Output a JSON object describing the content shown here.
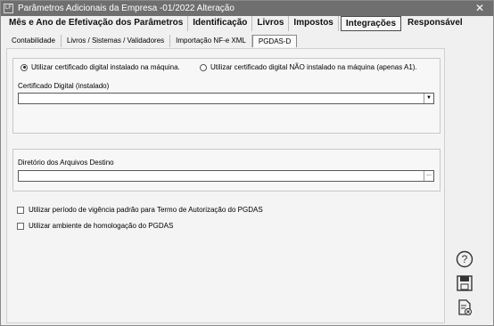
{
  "window": {
    "title": "Parâmetros Adicionais da Empresa -01/2022 Alteração",
    "icon_text": "LF",
    "close_icon": "close-icon"
  },
  "main_tabs": [
    {
      "label": "Mês e Ano de Efetivação dos Parâmetros",
      "active": false
    },
    {
      "label": "Identificação",
      "active": false
    },
    {
      "label": "Livros",
      "active": false
    },
    {
      "label": "Impostos",
      "active": false
    },
    {
      "label": "Integrações",
      "active": true
    },
    {
      "label": "Responsável",
      "active": false
    }
  ],
  "sub_tabs": [
    {
      "label": "Contabilidade",
      "active": false
    },
    {
      "label": "Livros / Sistemas / Validadores",
      "active": false
    },
    {
      "label": "Importação NF-e XML",
      "active": false
    },
    {
      "label": "PGDAS-D",
      "active": true
    }
  ],
  "certificate_group": {
    "radio_installed": {
      "label": "Utilizar certificado digital instalado na máquina.",
      "checked": true
    },
    "radio_not_installed": {
      "label": "Utilizar certificado digital NÃO instalado na máquina (apenas A1).",
      "checked": false
    },
    "cert_label": "Certificado Digital (instalado)",
    "cert_value": "",
    "dropdown_icon": "chevron-down-icon"
  },
  "directory_group": {
    "label": "Diretório dos Arquivos Destino",
    "value": "",
    "browse_label": "..."
  },
  "options": [
    {
      "label": "Utilizar período de vigência padrão para Termo de Autorização do PGDAS",
      "checked": false
    },
    {
      "label": "Utilizar ambiente de homologação do PGDAS",
      "checked": false
    }
  ],
  "side_tools": [
    {
      "icon": "help-icon"
    },
    {
      "icon": "save-icon"
    },
    {
      "icon": "exit-document-icon"
    }
  ]
}
